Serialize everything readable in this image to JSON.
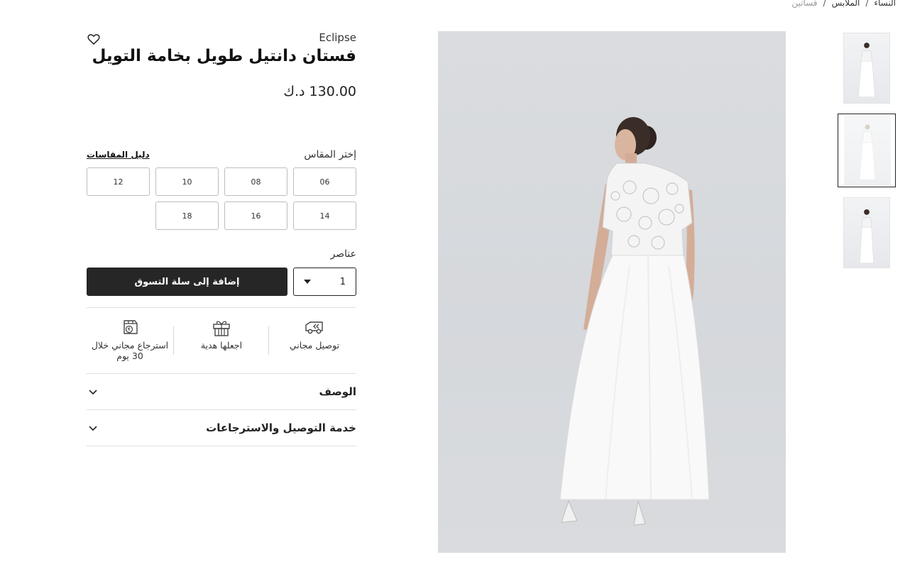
{
  "breadcrumb": {
    "items": [
      "النساء",
      "الملابس",
      "فساتين"
    ],
    "separator": "/"
  },
  "product": {
    "brand": "Eclipse",
    "title": "فستان دانتيل طويل بخامة التويل",
    "price": "130.00 د.ك",
    "wishlist_icon": "heart-icon"
  },
  "size": {
    "label": "إختر المقاس",
    "guide_label": "دليل المقاسات",
    "options": [
      "06",
      "08",
      "10",
      "12",
      "14",
      "16",
      "18"
    ]
  },
  "quantity": {
    "label": "عناصر",
    "value": "1"
  },
  "cart": {
    "add_label": "إضافة إلى سلة التسوق"
  },
  "features": [
    {
      "icon": "delivery-truck-icon",
      "label": "توصيل مجاني"
    },
    {
      "icon": "gift-icon",
      "label": "اجعلها هدية"
    },
    {
      "icon": "return-box-icon",
      "label": "استرجاع مجاني خلال 30 يوم"
    }
  ],
  "accordions": [
    {
      "label": "الوصف",
      "icon": "chevron-down-icon"
    },
    {
      "label": "خدمة التوصيل والاسترجاعات",
      "icon": "chevron-down-icon"
    }
  ],
  "colors": {
    "button_dark": "#262626",
    "image_bg": "#d8dadd",
    "selected_thumb_border": "#222222"
  }
}
